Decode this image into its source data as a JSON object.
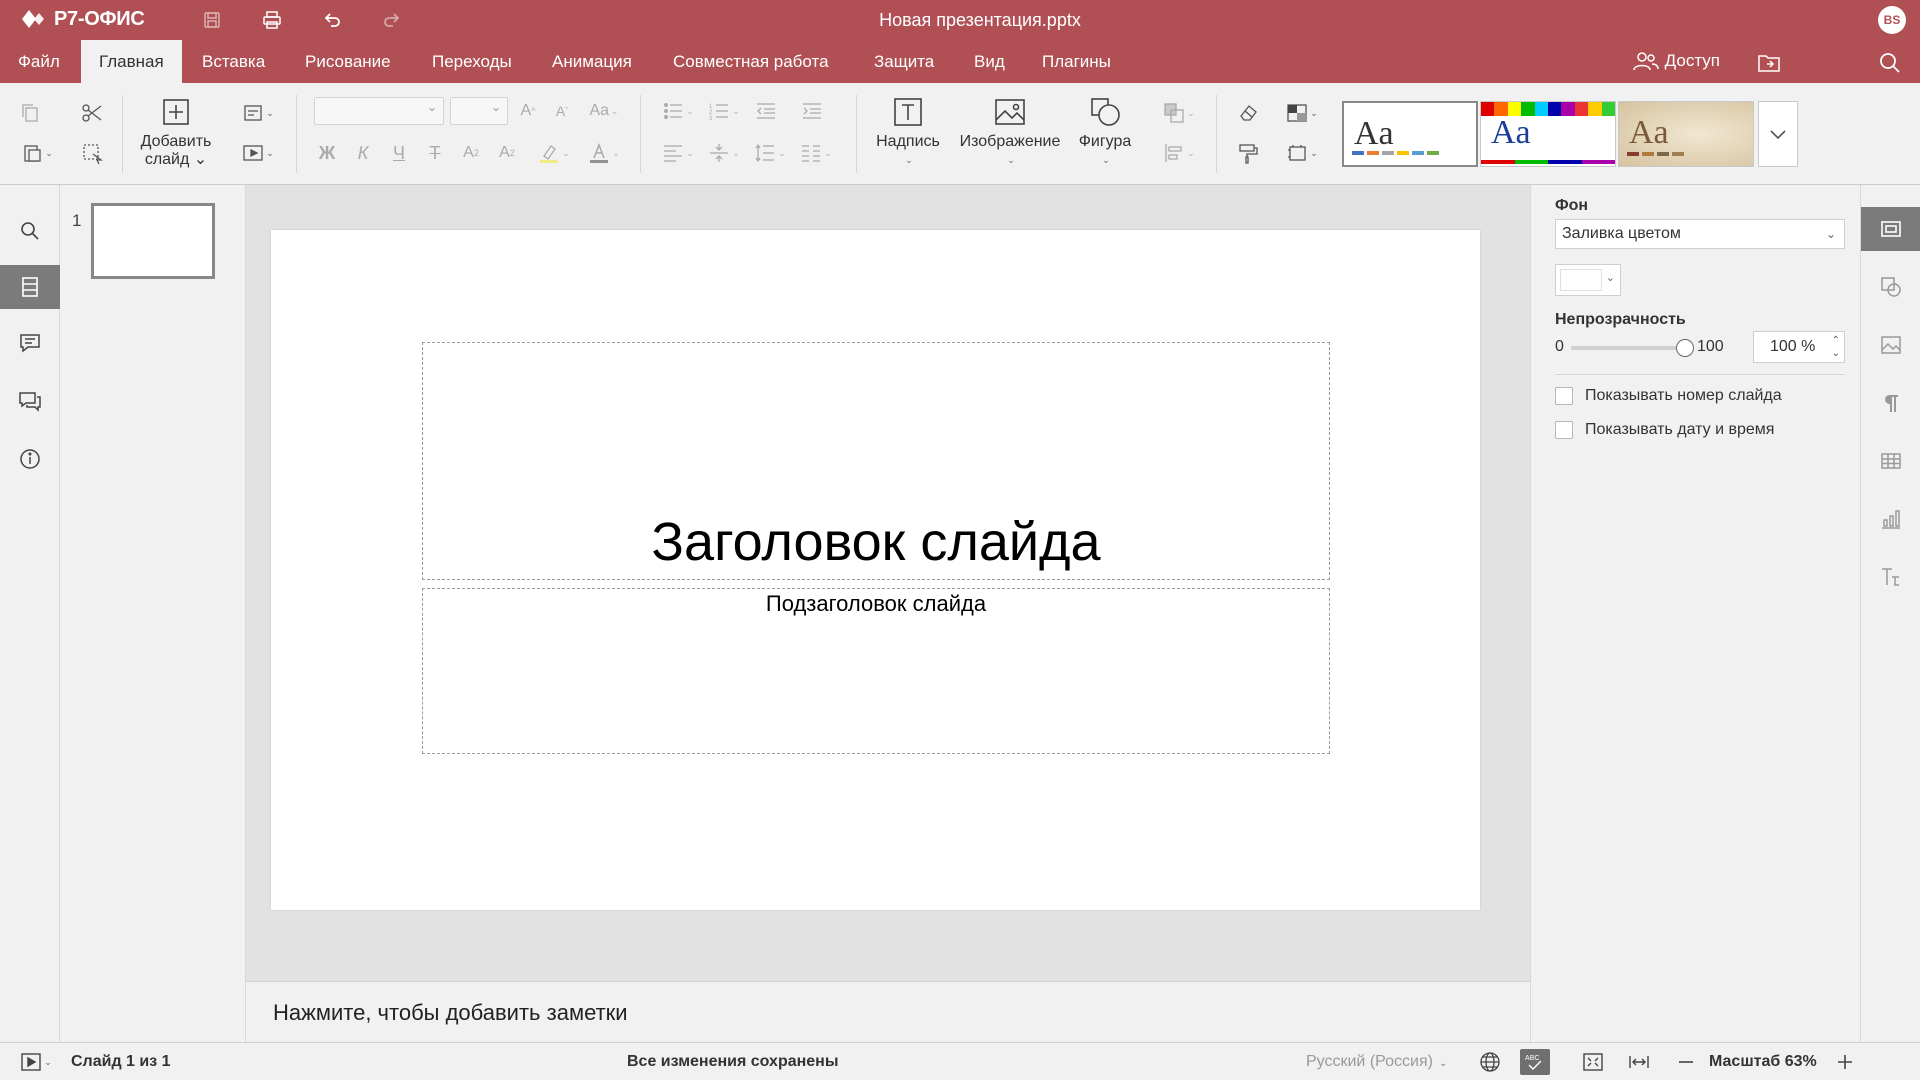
{
  "app": {
    "logo_text": "Р7-ОФИС",
    "doc_title": "Новая презентация.pptx",
    "user_initials": "BS",
    "brand_color": "#b05055"
  },
  "menu": {
    "tabs": [
      {
        "label": "Файл"
      },
      {
        "label": "Главная"
      },
      {
        "label": "Вставка"
      },
      {
        "label": "Рисование"
      },
      {
        "label": "Переходы"
      },
      {
        "label": "Анимация"
      },
      {
        "label": "Совместная работа"
      },
      {
        "label": "Защита"
      },
      {
        "label": "Вид"
      },
      {
        "label": "Плагины"
      }
    ],
    "active_tab": "Главная",
    "access_label": "Доступ"
  },
  "toolbar": {
    "add_slide_line1": "Добавить",
    "add_slide_line2": "слайд",
    "textbox_label": "Надпись",
    "image_label": "Изображение",
    "shape_label": "Фигура",
    "bold_glyph": "Ж",
    "italic_glyph": "К",
    "underline_glyph": "Ч",
    "strike_glyph": "Т",
    "themes": [
      {
        "sample": "Aa",
        "name": "blank"
      },
      {
        "sample": "Aa",
        "name": "colorful"
      },
      {
        "sample": "Aa",
        "name": "vintage"
      }
    ]
  },
  "thumbnails": {
    "slide_number": "1"
  },
  "slide": {
    "title": "Заголовок слайда",
    "subtitle": "Подзаголовок слайда"
  },
  "notes": {
    "placeholder": "Нажмите, чтобы добавить заметки"
  },
  "right_panel": {
    "background_label": "Фон",
    "fill_type": "Заливка цветом",
    "fill_color": "#ffffff",
    "opacity_label": "Непрозрачность",
    "opacity_min": "0",
    "opacity_max": "100",
    "opacity_value": "100 %",
    "opacity_level": 1.0,
    "show_slide_number": "Показывать номер слайда",
    "show_date_time": "Показывать дату и время"
  },
  "status": {
    "slide_position": "Слайд 1 из 1",
    "save_state": "Все изменения сохранены",
    "language": "Русский (Россия)",
    "zoom": "Масштаб 63%"
  }
}
